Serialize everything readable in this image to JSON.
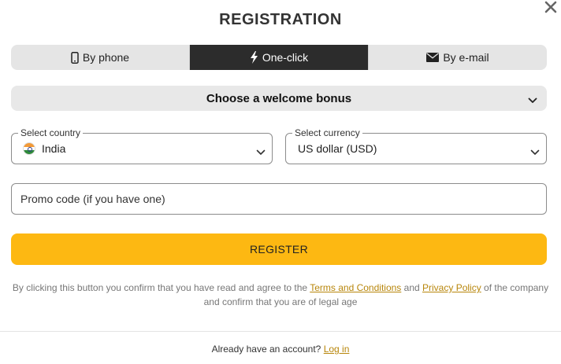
{
  "modal": {
    "title": "REGISTRATION"
  },
  "tabs": [
    {
      "label": "By phone",
      "icon": "phone-icon",
      "active": false
    },
    {
      "label": "One-click",
      "icon": "lightning-icon",
      "active": true
    },
    {
      "label": "By e-mail",
      "icon": "envelope-icon",
      "active": false
    }
  ],
  "bonus": {
    "label": "Choose a welcome bonus"
  },
  "country": {
    "legend": "Select country",
    "value": "India",
    "flag": "india-flag-icon"
  },
  "currency": {
    "legend": "Select currency",
    "value": "US dollar (USD)"
  },
  "promo": {
    "placeholder": "Promo code (if you have one)",
    "value": ""
  },
  "register": {
    "label": "REGISTER"
  },
  "terms": {
    "text_before": "By clicking this button you confirm that you have read and agree to the",
    "terms_link": "Terms and Conditions",
    "and": "and",
    "privacy_link": "Privacy Policy",
    "text_after": "of the company",
    "line2": "and confirm that you are of legal age"
  },
  "footer": {
    "text": "Already have an account?",
    "login_link": "Log in"
  },
  "colors": {
    "accent": "#fdb812",
    "active_tab": "#2c2c2c",
    "link": "#b8860b",
    "tab_bg": "#e5e5e5"
  }
}
